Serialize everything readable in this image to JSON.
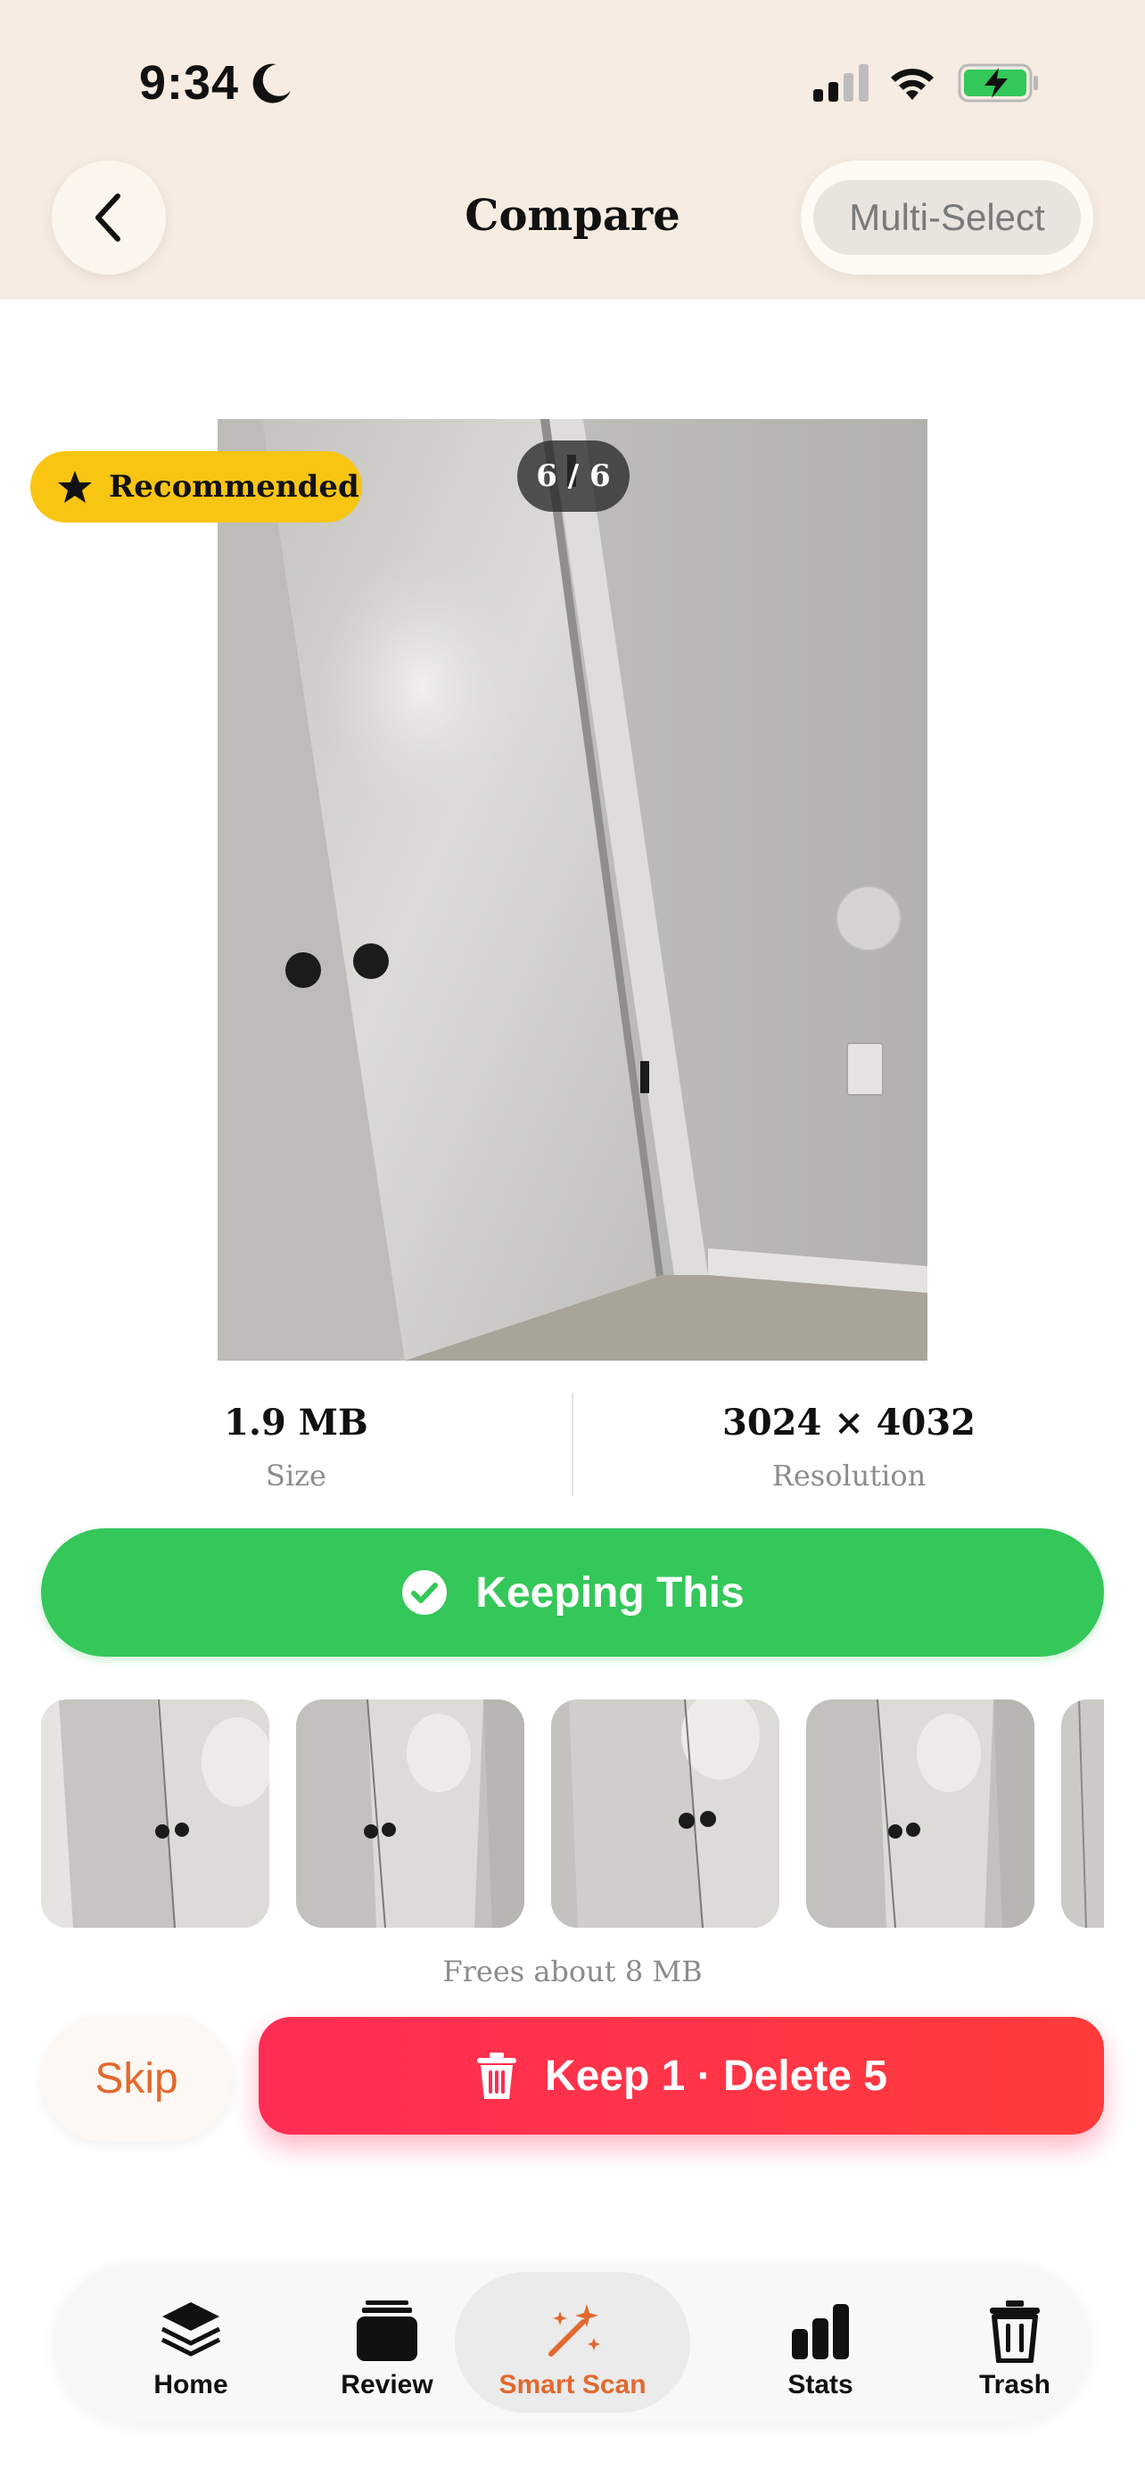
{
  "status_bar": {
    "time": "9:34"
  },
  "header": {
    "title": "Compare",
    "multi_select_label": "Multi-Select"
  },
  "photo": {
    "recommended_label": "Recommended",
    "counter": "6 / 6"
  },
  "info": {
    "size_value": "1.9 MB",
    "size_label": "Size",
    "resolution_value": "3024 × 4032",
    "resolution_label": "Resolution"
  },
  "keep_button_label": "Keeping This",
  "frees_text": "Frees about 8 MB",
  "actions": {
    "skip_label": "Skip",
    "delete_label": "Keep 1 · Delete 5"
  },
  "tabs": [
    {
      "label": "Home",
      "icon": "layers-icon",
      "active": false
    },
    {
      "label": "Review",
      "icon": "stack-icon",
      "active": false
    },
    {
      "label": "Smart Scan",
      "icon": "magic-wand-icon",
      "active": true
    },
    {
      "label": "Stats",
      "icon": "bar-chart-icon",
      "active": false
    },
    {
      "label": "Trash",
      "icon": "trash-icon",
      "active": false
    }
  ],
  "colors": {
    "header_bg": "#f7ece1",
    "accent": "#e2692f",
    "keep_green": "#34c759",
    "delete_red": "#ff2d55",
    "badge_yellow": "#f8c513"
  }
}
